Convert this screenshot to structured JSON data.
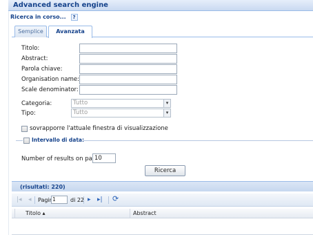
{
  "window": {
    "title": "Advanced search engine"
  },
  "status": {
    "text": "Ricerca in corso...",
    "help": "?"
  },
  "tabs": [
    {
      "label": "Semplice"
    },
    {
      "label": "Avanzata"
    }
  ],
  "form": {
    "fields": [
      {
        "label": "Titolo:",
        "value": ""
      },
      {
        "label": "Abstract:",
        "value": ""
      },
      {
        "label": "Parola chiave:",
        "value": ""
      },
      {
        "label": "Organisation name:",
        "value": ""
      },
      {
        "label": "Scale denominator:",
        "value": ""
      }
    ],
    "categoria": {
      "label": "Categoria:",
      "value": "Tutto"
    },
    "tipo": {
      "label": "Tipo:",
      "value": "Tutto"
    },
    "overlay_checkbox": {
      "label": "sovrapporre l'attuale finestra di visualizzazione",
      "checked": false
    },
    "date_interval": {
      "label": "Intervallo di data:",
      "checked": false
    },
    "results_per_page": {
      "label": "Number of results on page:",
      "value": "10"
    },
    "search_button": "Ricerca"
  },
  "results": {
    "header": "(risultati: 220)",
    "paging": {
      "label": "Pagina",
      "page": "1",
      "of_label": "di 22"
    },
    "columns": [
      {
        "label": "Titolo ▴"
      },
      {
        "label": "Abstract"
      }
    ]
  },
  "colors": {
    "accent": "#15428b",
    "border": "#99bbe8"
  },
  "icons": [
    "first-page-icon",
    "prev-page-icon",
    "next-page-icon",
    "last-page-icon",
    "refresh-icon",
    "dropdown-arrow-icon"
  ]
}
